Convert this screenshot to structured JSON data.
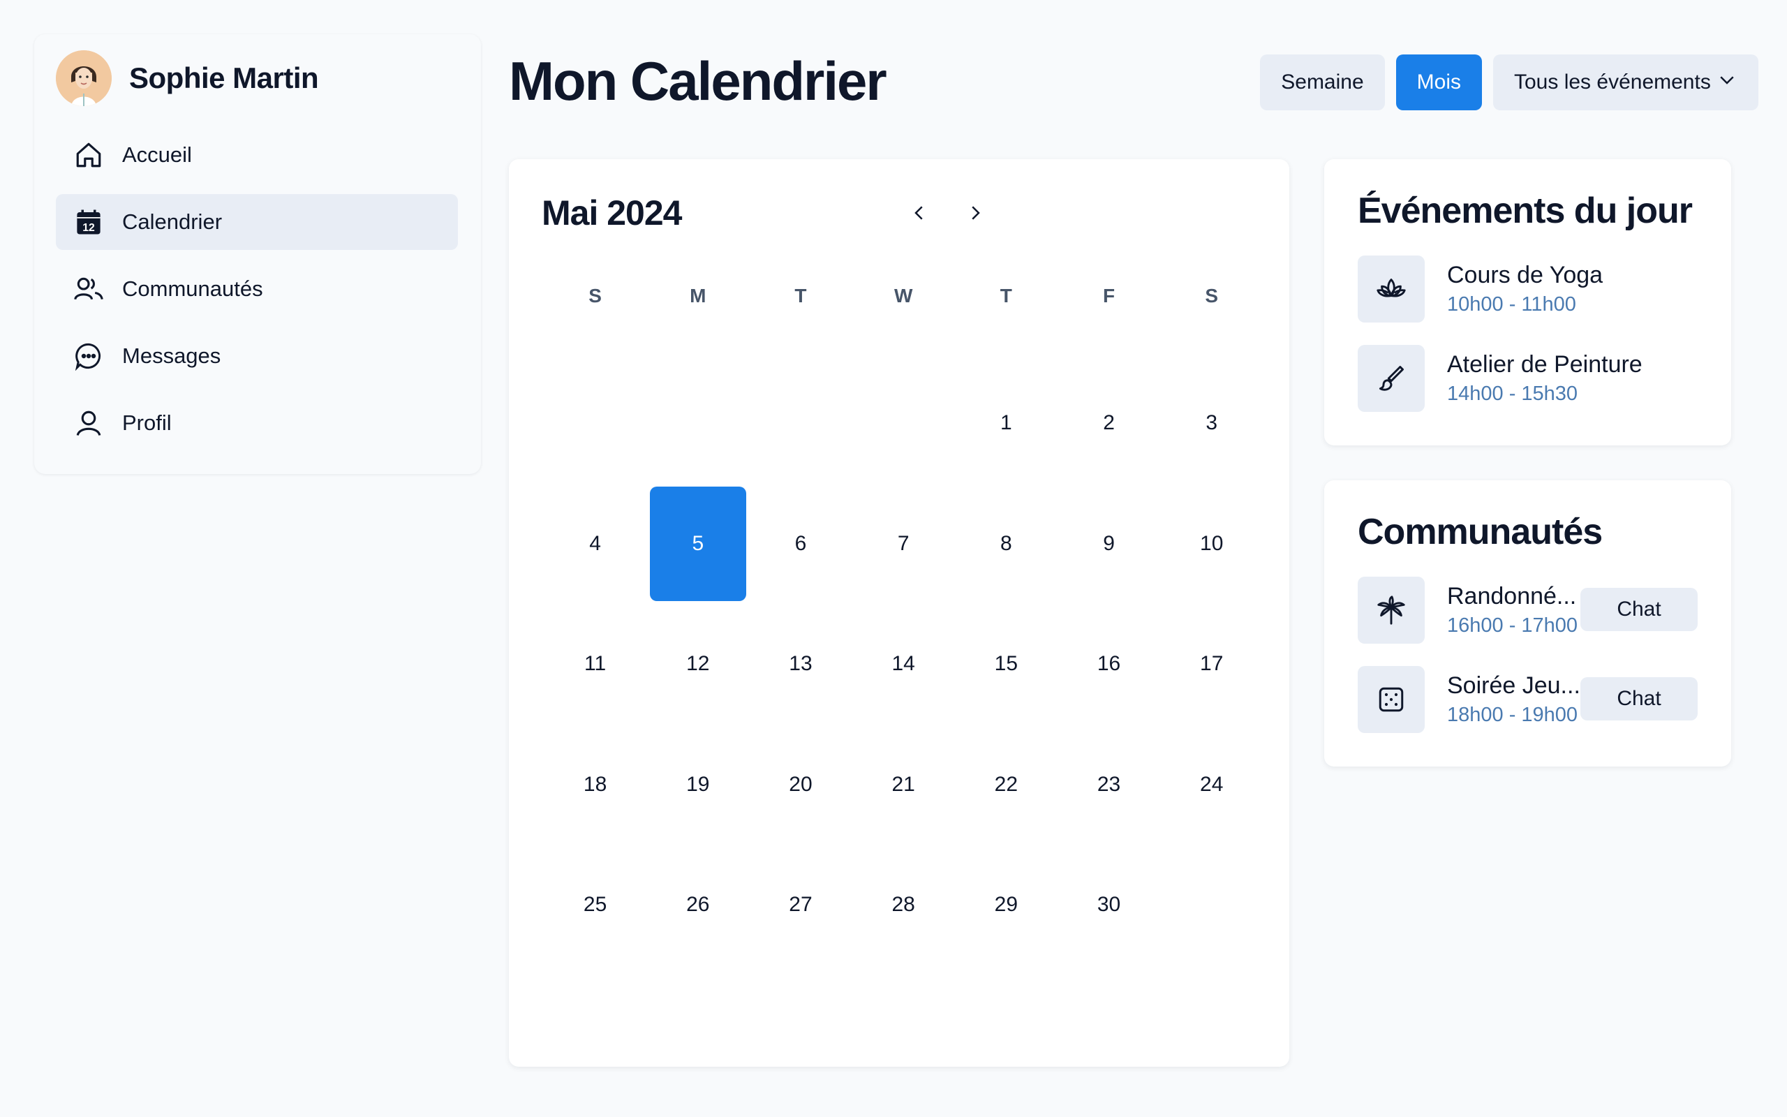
{
  "user": {
    "name": "Sophie Martin"
  },
  "nav": {
    "items": [
      {
        "label": "Accueil",
        "icon": "home-icon"
      },
      {
        "label": "Calendrier",
        "icon": "calendar-icon",
        "badge": "12",
        "active": true
      },
      {
        "label": "Communautés",
        "icon": "users-icon"
      },
      {
        "label": "Messages",
        "icon": "message-icon"
      },
      {
        "label": "Profil",
        "icon": "user-icon"
      }
    ]
  },
  "page": {
    "title": "Mon Calendrier"
  },
  "view": {
    "week_label": "Semaine",
    "month_label": "Mois",
    "active": "Mois",
    "filter_label": "Tous les événements"
  },
  "calendar": {
    "month_label": "Mai 2024",
    "weekdays": [
      "S",
      "M",
      "T",
      "W",
      "T",
      "F",
      "S"
    ],
    "days": [
      "",
      "",
      "",
      "",
      "1",
      "2",
      "3",
      "4",
      "5",
      "6",
      "7",
      "8",
      "9",
      "10",
      "11",
      "12",
      "13",
      "14",
      "15",
      "16",
      "17",
      "18",
      "19",
      "20",
      "21",
      "22",
      "23",
      "24",
      "25",
      "26",
      "27",
      "28",
      "29",
      "30",
      ""
    ],
    "selected_day": "5"
  },
  "today_events": {
    "title": "Événements du jour",
    "items": [
      {
        "name": "Cours de Yoga",
        "time": "10h00 - 11h00",
        "icon": "lotus-icon"
      },
      {
        "name": "Atelier de Peinture",
        "time": "14h00 - 15h30",
        "icon": "paintbrush-icon"
      }
    ]
  },
  "communities": {
    "title": "Communautés",
    "items": [
      {
        "name": "Randonné...",
        "time": "16h00 - 17h00",
        "icon": "palm-tree-icon",
        "action": "Chat"
      },
      {
        "name": "Soirée Jeu...",
        "time": "18h00 - 19h00",
        "icon": "dice-icon",
        "action": "Chat"
      }
    ]
  },
  "colors": {
    "accent": "#1a7fe8",
    "background": "#f8fafc",
    "muted_surface": "#e8edf5",
    "time_text": "#4a7ab0"
  }
}
